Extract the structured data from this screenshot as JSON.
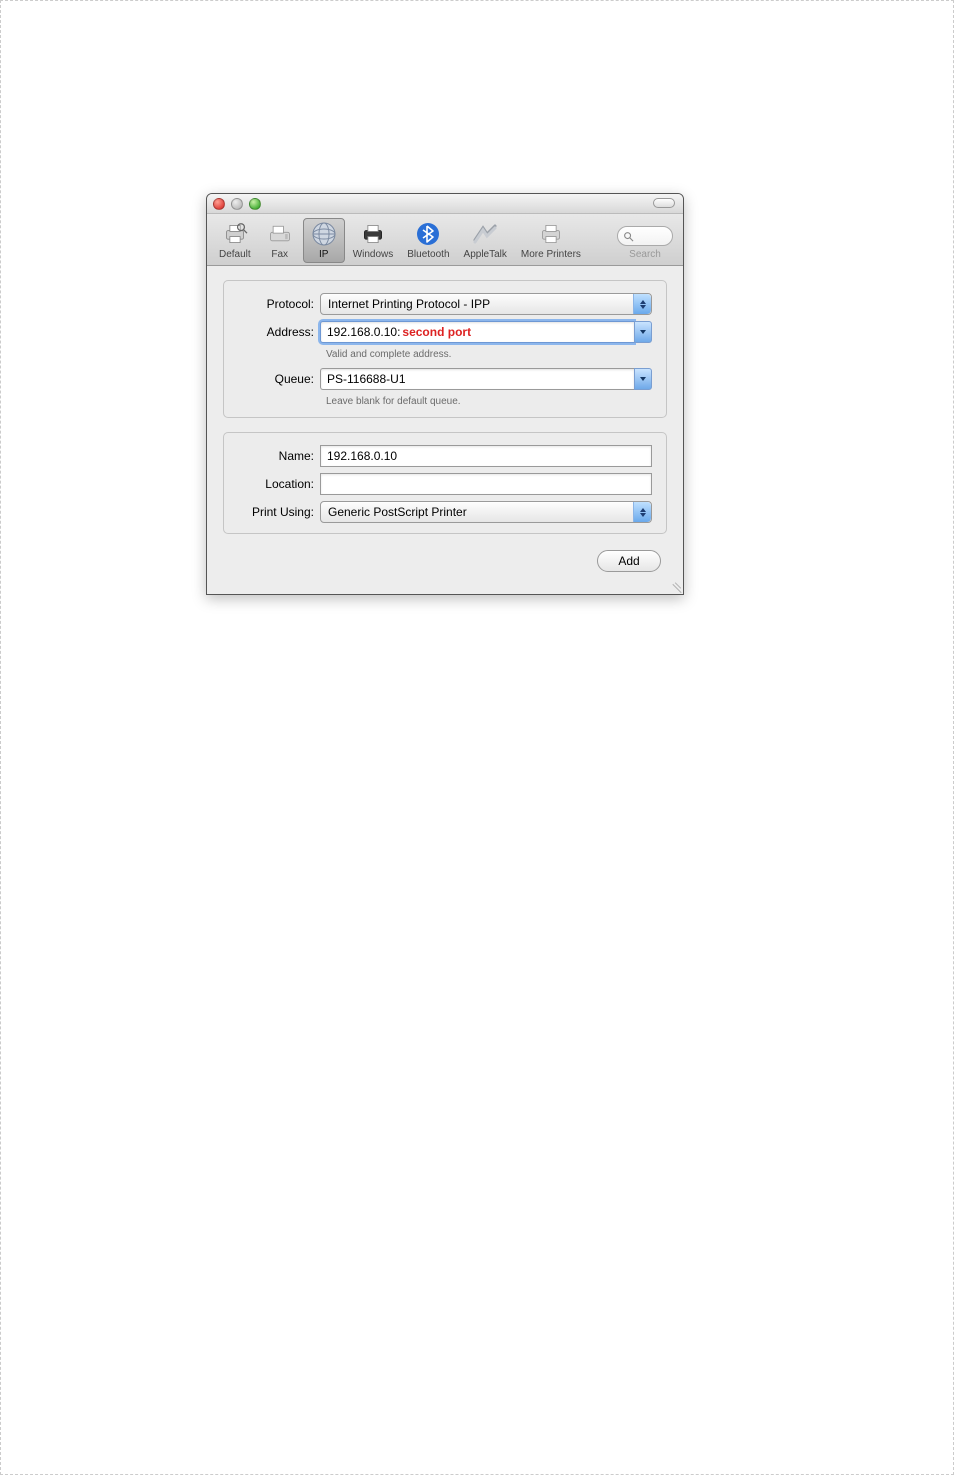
{
  "toolbar": {
    "items": [
      {
        "label": "Default"
      },
      {
        "label": "Fax"
      },
      {
        "label": "IP"
      },
      {
        "label": "Windows"
      },
      {
        "label": "Bluetooth"
      },
      {
        "label": "AppleTalk"
      },
      {
        "label": "More Printers"
      }
    ],
    "search_label": "Search"
  },
  "form": {
    "protocol_label": "Protocol:",
    "protocol_value": "Internet Printing Protocol - IPP",
    "address_label": "Address:",
    "address_value_part1": "192.168.0.10:",
    "address_value_part2": "second port",
    "address_hint": "Valid and complete address.",
    "queue_label": "Queue:",
    "queue_value": "PS-116688-U1",
    "queue_hint": "Leave blank for default queue.",
    "name_label": "Name:",
    "name_value": "192.168.0.10",
    "location_label": "Location:",
    "location_value": "",
    "printusing_label": "Print Using:",
    "printusing_value": "Generic PostScript Printer"
  },
  "buttons": {
    "add": "Add"
  }
}
